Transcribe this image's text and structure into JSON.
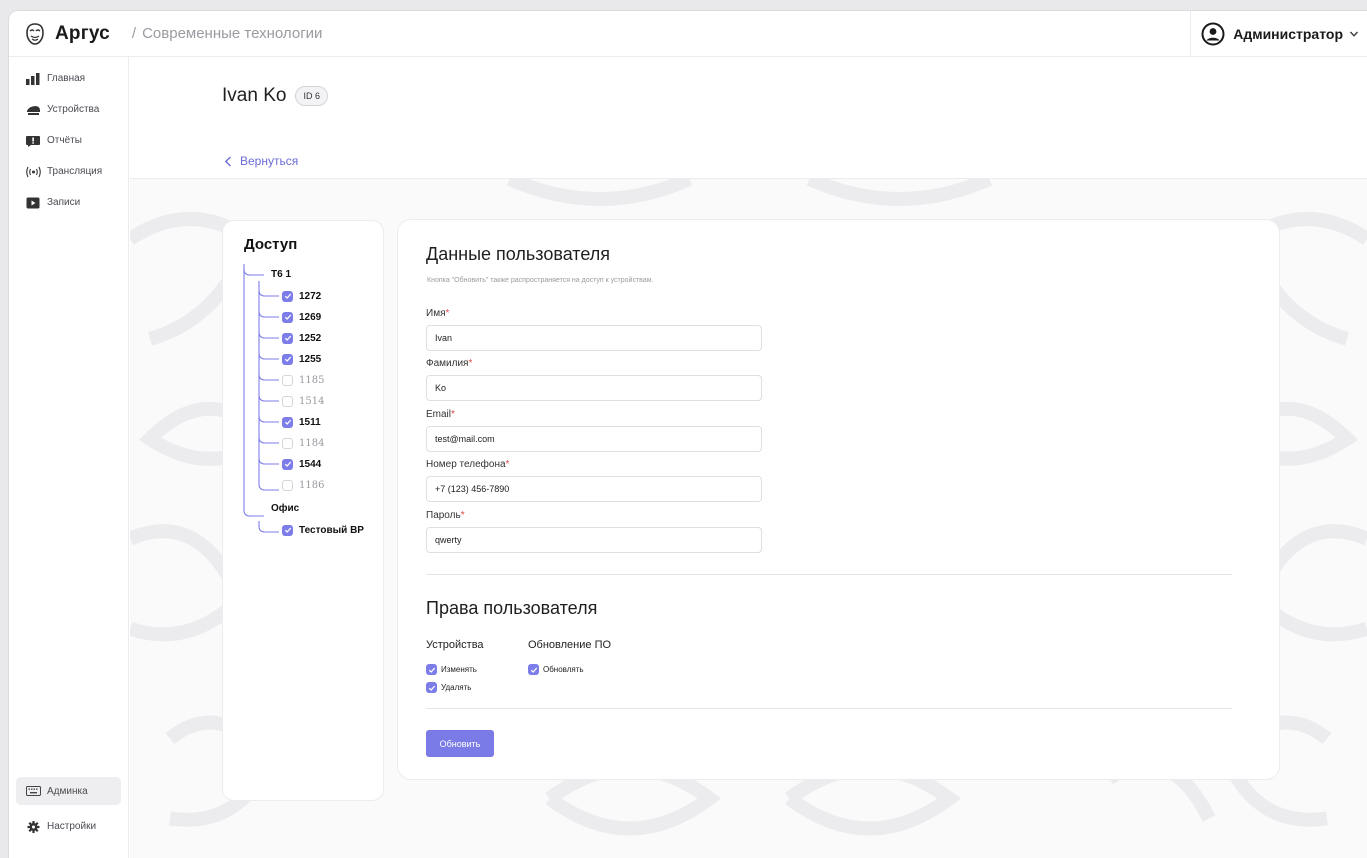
{
  "header": {
    "app_name": "Аргус",
    "breadcrumb_sep": "/",
    "breadcrumb": "Современные технологии",
    "user_name": "Администратор"
  },
  "sidebar": {
    "items": [
      {
        "label": "Главная",
        "icon": "bar-chart-icon"
      },
      {
        "label": "Устройства",
        "icon": "camera-icon"
      },
      {
        "label": "Отчёты",
        "icon": "report-icon"
      },
      {
        "label": "Трансляция",
        "icon": "broadcast-icon"
      },
      {
        "label": "Записи",
        "icon": "play-icon"
      }
    ],
    "bottom": [
      {
        "label": "Админка",
        "icon": "keyboard-icon",
        "active": true
      },
      {
        "label": "Настройки",
        "icon": "gear-icon"
      }
    ]
  },
  "page": {
    "title": "Ivan Ko",
    "id_badge": "ID 6",
    "back_label": "Вернуться"
  },
  "access": {
    "title": "Доступ",
    "groups": [
      {
        "name": "Т6 1",
        "items": [
          {
            "label": "1272",
            "checked": true
          },
          {
            "label": "1269",
            "checked": true
          },
          {
            "label": "1252",
            "checked": true
          },
          {
            "label": "1255",
            "checked": true
          },
          {
            "label": "1185",
            "checked": false
          },
          {
            "label": "1514",
            "checked": false
          },
          {
            "label": "1511",
            "checked": true
          },
          {
            "label": "1184",
            "checked": false
          },
          {
            "label": "1544",
            "checked": true
          },
          {
            "label": "1186",
            "checked": false
          }
        ]
      },
      {
        "name": "Офис",
        "items": [
          {
            "label": "Тестовый ВР",
            "checked": true
          }
        ]
      }
    ]
  },
  "form": {
    "title": "Данные пользователя",
    "hint": "Кнопка \"Обновить\" также распространяется на доступ к устройствам.",
    "fields": [
      {
        "label": "Имя",
        "value": "Ivan"
      },
      {
        "label": "Фамилия",
        "value": "Ko"
      },
      {
        "label": "Email",
        "value": "test@mail.com"
      },
      {
        "label": "Номер телефона",
        "value": "+7 (123) 456-7890"
      },
      {
        "label": "Пароль",
        "value": "qwerty"
      }
    ],
    "required_mark": "*",
    "rights_title": "Права пользователя",
    "rights": {
      "devices_head": "Устройства",
      "devices": [
        {
          "label": "Изменять",
          "checked": true
        },
        {
          "label": "Удалять",
          "checked": true
        }
      ],
      "firmware_head": "Обновление ПО",
      "firmware": [
        {
          "label": "Обновлять",
          "checked": true
        }
      ]
    },
    "submit_label": "Обновить"
  },
  "colors": {
    "accent": "#7b7be8",
    "link": "#6b6bd6",
    "required": "#e04848"
  }
}
